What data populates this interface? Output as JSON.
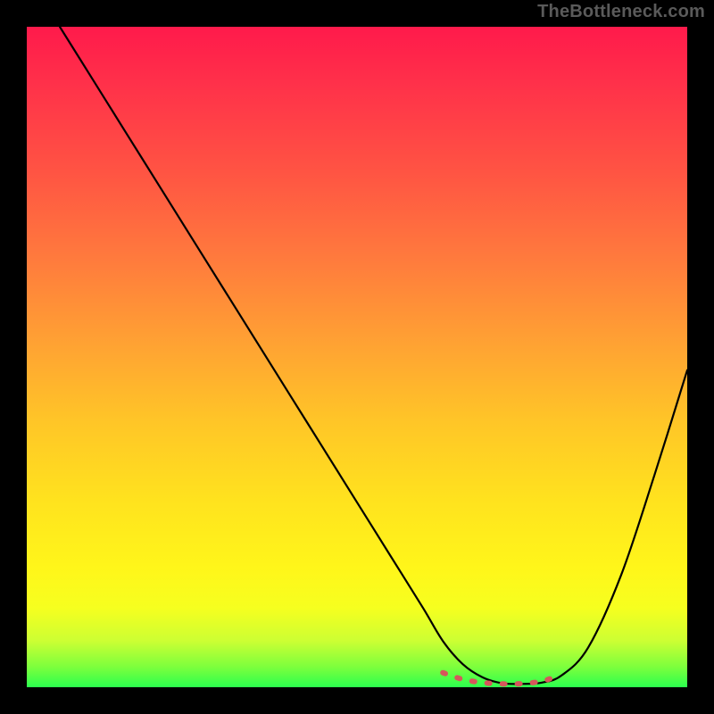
{
  "watermark": "TheBottleneck.com",
  "chart_data": {
    "type": "line",
    "title": "",
    "xlabel": "",
    "ylabel": "",
    "xlim": [
      0,
      100
    ],
    "ylim": [
      0,
      100
    ],
    "grid": false,
    "legend": false,
    "description": "Bottleneck curve over a red-to-green vertical gradient. The black line descends from top-left to a minimum near x≈72 then rises toward the right. A short crimson dashed segment marks the minimum region.",
    "series": [
      {
        "name": "bottleneck-curve",
        "color": "#000000",
        "x": [
          5,
          10,
          15,
          20,
          25,
          30,
          35,
          40,
          45,
          50,
          55,
          60,
          63,
          66,
          69,
          72,
          75,
          78,
          81,
          85,
          90,
          95,
          100
        ],
        "y": [
          100,
          92,
          84,
          76,
          68,
          60,
          52,
          44,
          36,
          28,
          20,
          12,
          7,
          3.5,
          1.5,
          0.6,
          0.5,
          0.7,
          1.8,
          6,
          17,
          32,
          48
        ]
      },
      {
        "name": "min-marker",
        "color": "#d6575b",
        "style": "dashed",
        "x": [
          63,
          66,
          69,
          72,
          75,
          78,
          80
        ],
        "y": [
          2.2,
          1.2,
          0.7,
          0.5,
          0.55,
          0.9,
          1.6
        ]
      }
    ]
  }
}
